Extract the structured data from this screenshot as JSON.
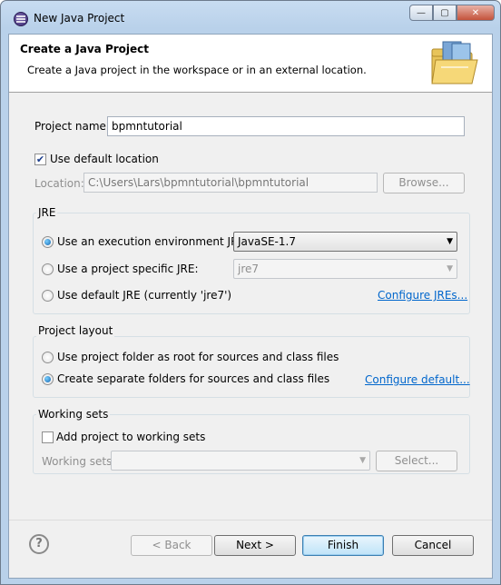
{
  "window": {
    "title": "New Java Project",
    "controls": {
      "minimize": "—",
      "maximize": "▢",
      "close": "✕"
    }
  },
  "header": {
    "title": "Create a Java Project",
    "description": "Create a Java project in the workspace or in an external location."
  },
  "project": {
    "name_label": "Project name:",
    "name_value": "bpmntutorial",
    "use_default_label": "Use default location",
    "use_default_checked": true,
    "location_label": "Location:",
    "location_value": "C:\\Users\\Lars\\bpmntutorial\\bpmntutorial",
    "browse_label": "Browse..."
  },
  "jre": {
    "title": "JRE",
    "option_env_label": "Use an execution environment JRE:",
    "option_env_value": "JavaSE-1.7",
    "option_specific_label": "Use a project specific JRE:",
    "option_specific_value": "jre7",
    "option_default_label": "Use default JRE (currently 'jre7')",
    "configure_link": "Configure JREs..."
  },
  "layout": {
    "title": "Project layout",
    "option_root_label": "Use project folder as root for sources and class files",
    "option_separate_label": "Create separate folders for sources and class files",
    "configure_link": "Configure default..."
  },
  "working_sets": {
    "title": "Working sets",
    "add_label": "Add project to working sets",
    "add_checked": false,
    "sets_label": "Working sets:",
    "sets_value": "",
    "select_label": "Select..."
  },
  "footer": {
    "help": "?",
    "back_label": "< Back",
    "next_label": "Next >",
    "finish_label": "Finish",
    "cancel_label": "Cancel"
  },
  "colors": {
    "link": "#0066cc",
    "window_frame": "#b9d1ea",
    "dialog_bg": "#f0f0f0"
  }
}
